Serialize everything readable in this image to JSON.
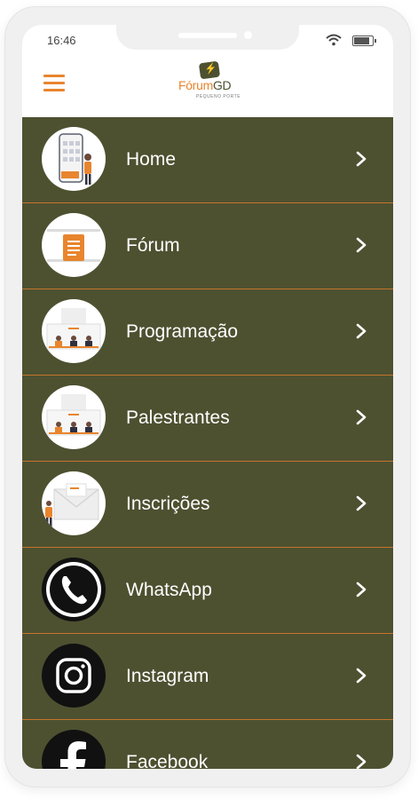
{
  "status_bar": {
    "time": "16:46"
  },
  "header": {
    "logo_prefix": "Fórum",
    "logo_suffix": "GD",
    "logo_subtitle": "PEQUENO PORTE"
  },
  "menu": {
    "items": [
      {
        "label": "Home",
        "icon": "phone-app-illustration-icon"
      },
      {
        "label": "Fórum",
        "icon": "document-illustration-icon"
      },
      {
        "label": "Programação",
        "icon": "schedule-illustration-icon"
      },
      {
        "label": "Palestrantes",
        "icon": "speakers-illustration-icon"
      },
      {
        "label": "Inscrições",
        "icon": "envelope-illustration-icon"
      },
      {
        "label": "WhatsApp",
        "icon": "whatsapp-icon"
      },
      {
        "label": "Instagram",
        "icon": "instagram-icon"
      },
      {
        "label": "Facebook",
        "icon": "facebook-icon"
      }
    ]
  },
  "colors": {
    "menu_background": "#4d5130",
    "separator": "#c6742c",
    "accent": "#e8852e"
  }
}
